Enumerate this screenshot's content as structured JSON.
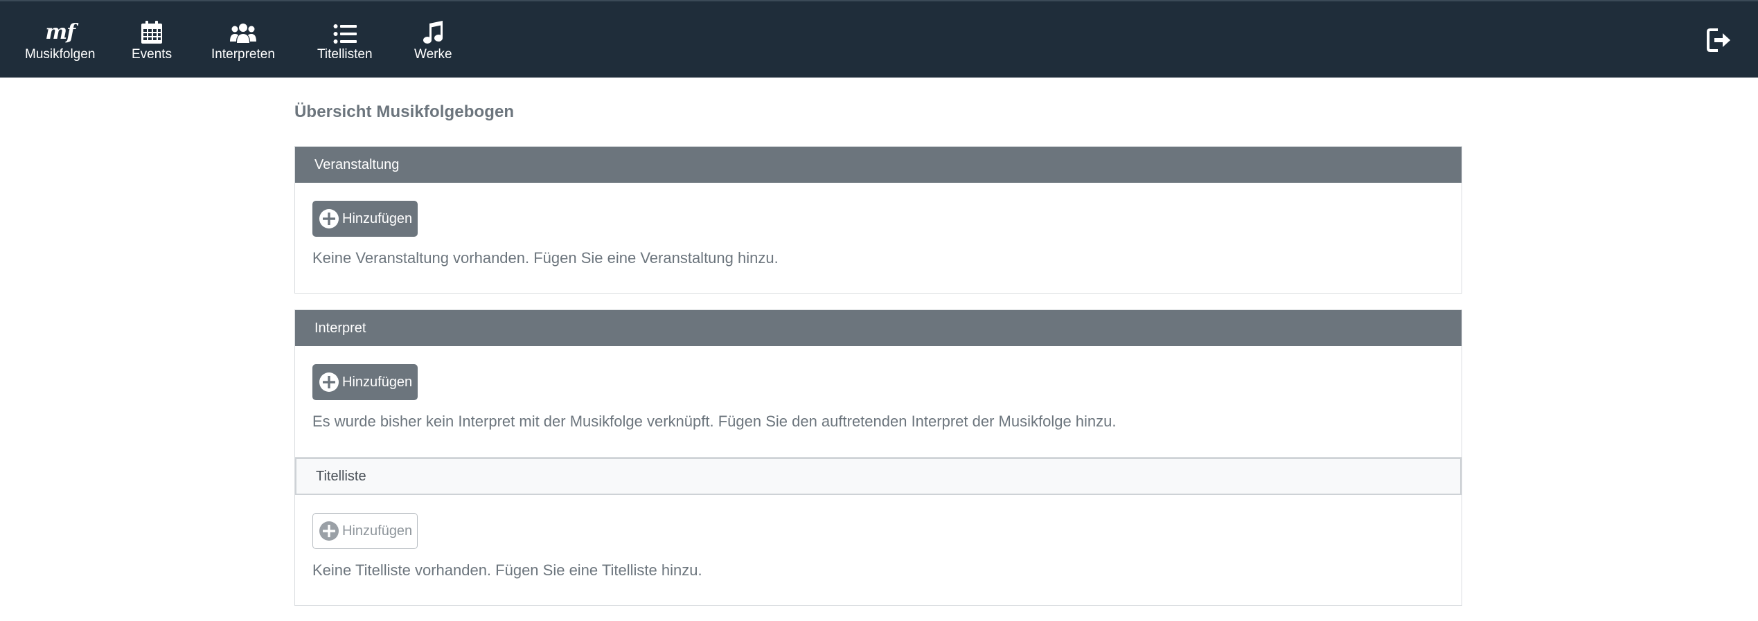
{
  "nav": {
    "items": [
      {
        "label": "Musikfolgen",
        "icon": "mf-logo-icon",
        "logo_text": "mf"
      },
      {
        "label": "Events",
        "icon": "calendar-icon"
      },
      {
        "label": "Interpreten",
        "icon": "users-icon"
      },
      {
        "label": "Titellisten",
        "icon": "list-icon"
      },
      {
        "label": "Werke",
        "icon": "music-note-icon"
      }
    ],
    "logout_icon": "logout-icon"
  },
  "page": {
    "title": "Übersicht Musikfolgebogen"
  },
  "sections": [
    {
      "header": "Veranstaltung",
      "button": "Hinzufügen",
      "message": "Keine Veranstaltung vorhanden. Fügen Sie eine Veranstaltung hinzu."
    },
    {
      "header": "Interpret",
      "button": "Hinzufügen",
      "message": "Es wurde bisher kein Interpret mit der Musikfolge verknüpft. Fügen Sie den auftretenden Interpret der Musikfolge hinzu."
    },
    {
      "header": "Titelliste",
      "button": "Hinzufügen",
      "message": "Keine Titelliste vorhanden. Fügen Sie eine Titelliste hinzu."
    }
  ],
  "colors": {
    "navbar": "#1f2d3a",
    "header_dark": "#6c757d",
    "header_light": "#f8f9fa",
    "text_muted": "#6c757d"
  }
}
